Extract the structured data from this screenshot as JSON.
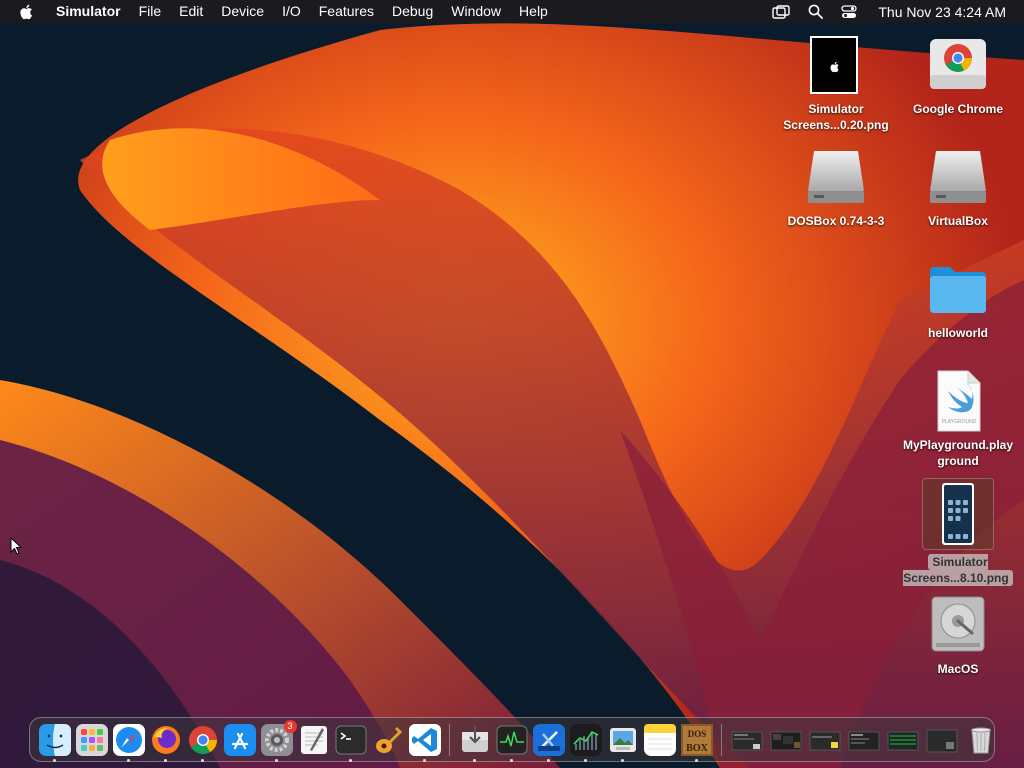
{
  "menubar": {
    "app_name": "Simulator",
    "items": [
      "File",
      "Edit",
      "Device",
      "I/O",
      "Features",
      "Debug",
      "Window",
      "Help"
    ],
    "clock": "Thu Nov 23  4:24 AM"
  },
  "desktop": {
    "icons": [
      {
        "label": "Simulator Screens...0.20.png",
        "icon": "screenshot-dark-icon"
      },
      {
        "label": "Google Chrome",
        "icon": "chrome-disk-icon"
      },
      {
        "label": "DOSBox 0.74-3-3",
        "icon": "disk-image-icon"
      },
      {
        "label": "VirtualBox",
        "icon": "disk-image-icon"
      },
      {
        "label": "helloworld",
        "icon": "folder-icon"
      },
      {
        "label": "MyPlayground.playground",
        "icon": "swift-playground-icon"
      },
      {
        "label": "Simulator Screens...8.10.png",
        "icon": "screenshot-phone-icon"
      },
      {
        "label": "MacOS",
        "icon": "hard-drive-icon"
      }
    ]
  },
  "dock": {
    "settings_badge": "3",
    "apps": [
      "Finder",
      "Launchpad",
      "Safari",
      "Firefox",
      "Google Chrome",
      "App Store",
      "System Settings",
      "TextEdit",
      "Terminal",
      "GarageBand",
      "Visual Studio Code",
      "Installer",
      "Activity Monitor",
      "Xcode Instruments",
      "Stocks",
      "Preview",
      "Notes",
      "DOSBox"
    ]
  },
  "colors": {
    "menubar_bg": "#1c1a1e",
    "wallpaper_orange": "#ff9a1a",
    "wallpaper_red": "#c8331a",
    "wallpaper_dark": "#0a1c2c"
  }
}
